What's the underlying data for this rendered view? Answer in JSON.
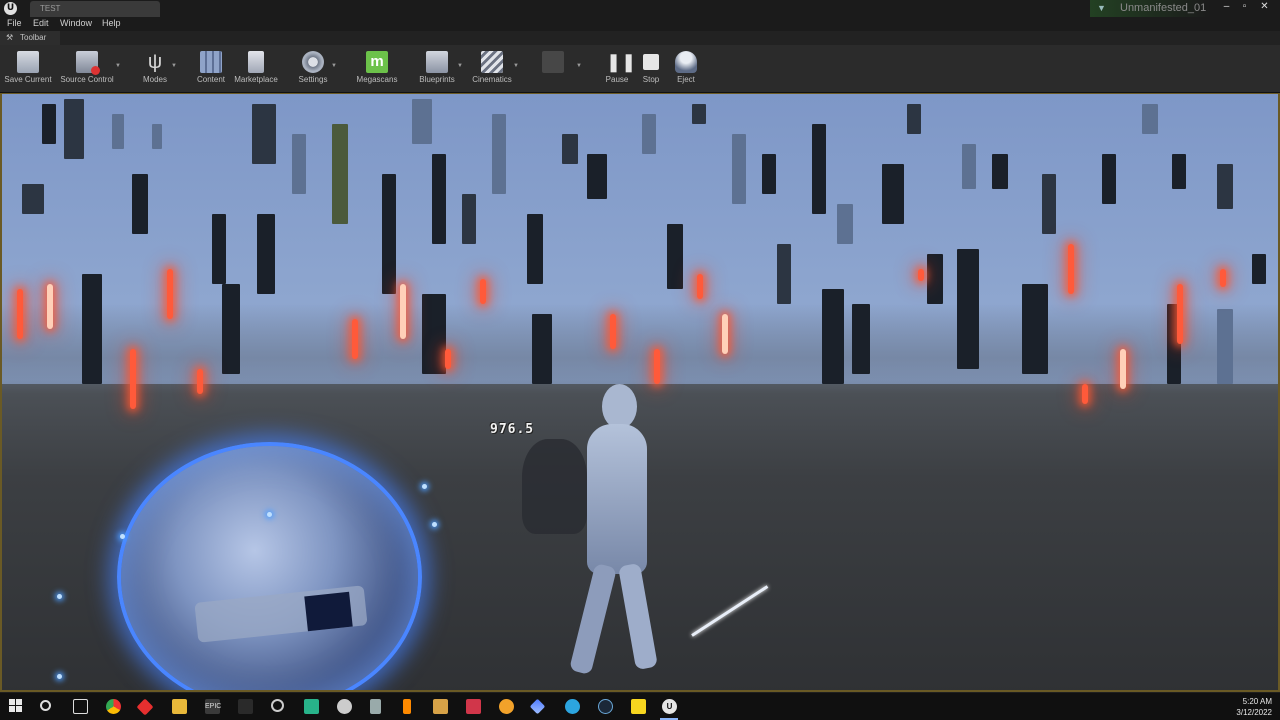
{
  "window": {
    "tab_title": "TEST",
    "project_name": "Unmanifested_01",
    "minimize": "–",
    "maximize": "▫",
    "close": "✕"
  },
  "menu": {
    "file": "File",
    "edit": "Edit",
    "window": "Window",
    "help": "Help"
  },
  "toolbar_tab": {
    "label": "Toolbar"
  },
  "toolbar": {
    "save_current": "Save Current",
    "source_control": "Source Control",
    "modes": "Modes",
    "content": "Content",
    "marketplace": "Marketplace",
    "settings": "Settings",
    "megascans": "Megascans",
    "blueprints": "Blueprints",
    "cinematics": "Cinematics",
    "pause": "Pause",
    "stop": "Stop",
    "eject": "Eject"
  },
  "viewport": {
    "damage_number": "976.5"
  },
  "taskbar": {
    "time": "5:20 AM",
    "date": "3/12/2022"
  },
  "colors": {
    "accent_blue": "#4a86ff",
    "glow_red": "#ff5a3a",
    "megascans_green": "#6cc24a",
    "viewport_border": "#6a5a25"
  }
}
